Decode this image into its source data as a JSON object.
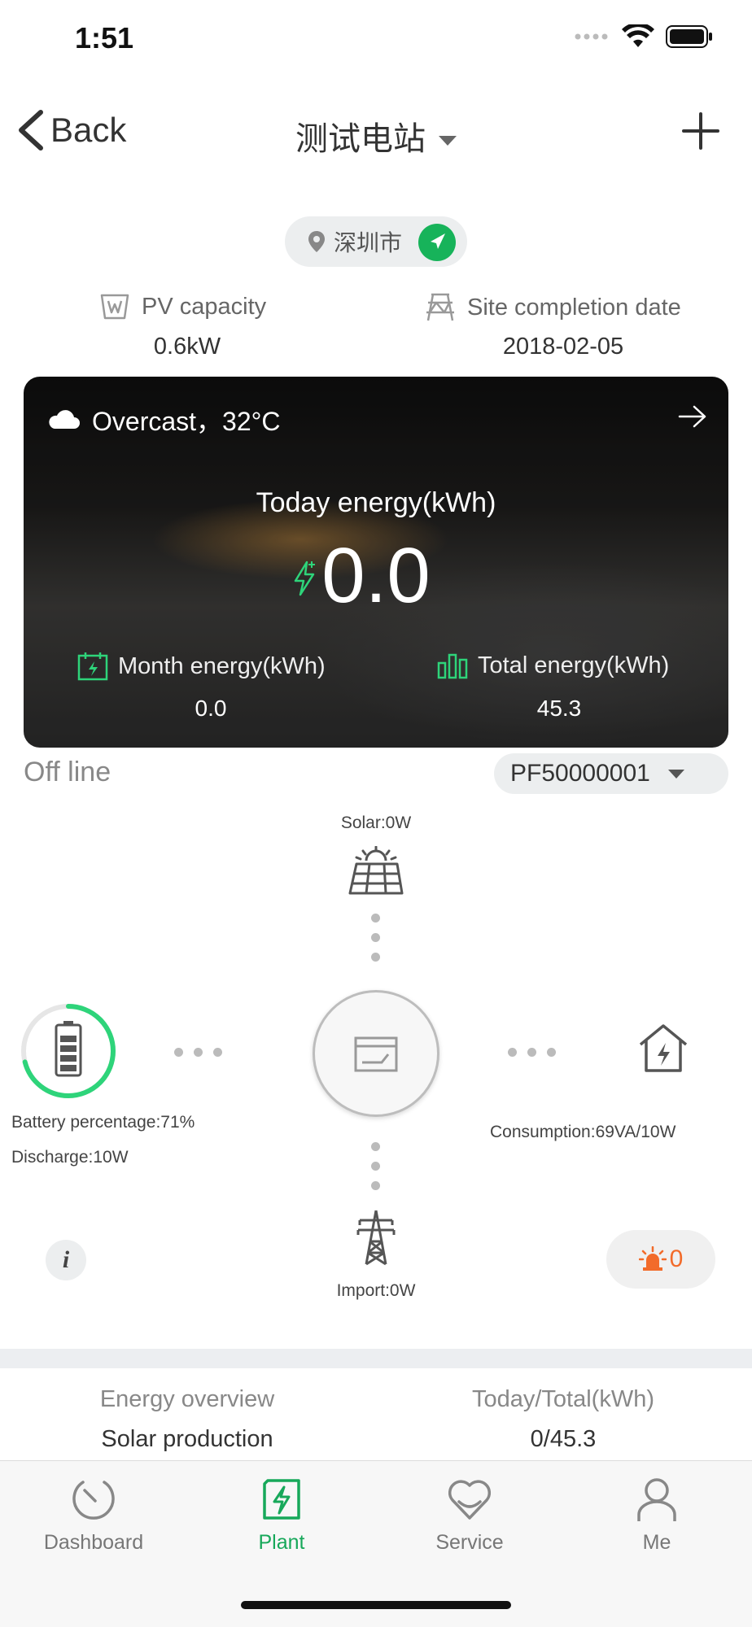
{
  "status_bar": {
    "time": "1:51"
  },
  "nav": {
    "back_label": "Back",
    "title": "测试电站"
  },
  "location": {
    "city": "深圳市"
  },
  "site_meta": {
    "pv_capacity_label": "PV capacity",
    "pv_capacity_value": "0.6kW",
    "completion_label": "Site completion date",
    "completion_value": "2018-02-05"
  },
  "energy_card": {
    "weather": "Overcast，32°C",
    "today_label": "Today energy(kWh)",
    "today_value": "0.0",
    "month_label": "Month energy(kWh)",
    "month_value": "0.0",
    "total_label": "Total energy(kWh)",
    "total_value": "45.3"
  },
  "device": {
    "status": "Off line",
    "serial": "PF50000001"
  },
  "flow": {
    "solar": "Solar:0W",
    "battery_percentage": "Battery percentage:71%",
    "battery_level_pct": 71,
    "discharge": "Discharge:10W",
    "consumption": "Consumption:69VA/10W",
    "import": "Import:0W",
    "alarm_count": "0",
    "info_glyph": "i"
  },
  "overview": {
    "header_left": "Energy overview",
    "header_right": "Today/Total(kWh)",
    "rows": [
      {
        "label": "Solar production",
        "value": "0/45.3"
      }
    ]
  },
  "tabs": [
    {
      "label": "Dashboard",
      "icon": "dashboard-icon"
    },
    {
      "label": "Plant",
      "icon": "plant-icon"
    },
    {
      "label": "Service",
      "icon": "service-icon"
    },
    {
      "label": "Me",
      "icon": "me-icon"
    }
  ],
  "colors": {
    "accent": "#17a85a",
    "alarm": "#f26b2a",
    "ring": "#2ed47a"
  }
}
